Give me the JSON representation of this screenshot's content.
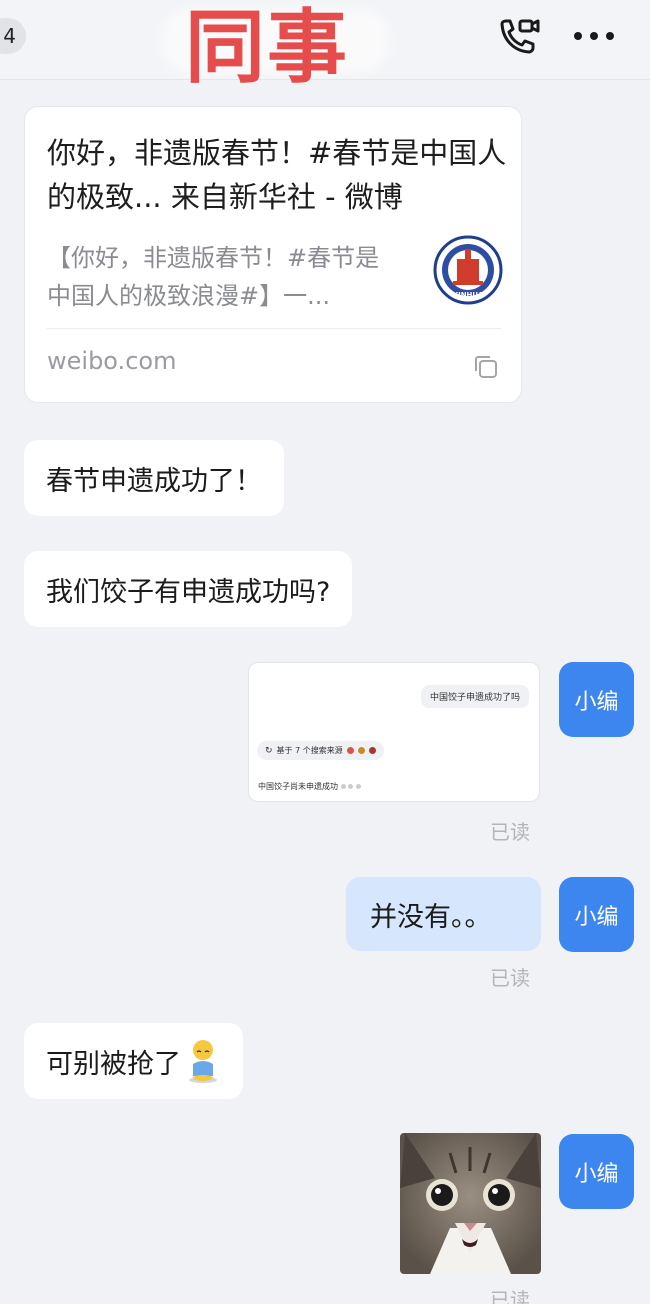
{
  "header": {
    "badge": "4",
    "title": "同事",
    "call_icon": "video-call-icon",
    "more_icon": "more-icon"
  },
  "link_card": {
    "title": "你好，非遗版春节！#春节是中国人的极致... 来自新华社 - 微博",
    "description": "【你好，非遗版春节！#春节是中国人的极致浪漫#】一...",
    "logo_text": "XINHUA",
    "domain": "weibo.com",
    "copy_icon": "copy-icon"
  },
  "messages": {
    "m1": "春节申遗成功了！",
    "m2": "我们饺子有申遗成功吗?",
    "m4": "并没有。。",
    "m5": "可别被抢了",
    "m5_emoji": "sitting-sad-emoji"
  },
  "screenshot_image": {
    "question": "中国饺子申遗成功了吗",
    "sources": "基于 7 个搜索来源",
    "answer": "中国饺子尚未申遗成功"
  },
  "avatar_label": "小编",
  "read_label": "已读",
  "colors": {
    "background": "#f1f2f6",
    "outgoing_bubble": "#d6e6fd",
    "avatar": "#3d86ef",
    "title_red": "#e64c4c"
  }
}
